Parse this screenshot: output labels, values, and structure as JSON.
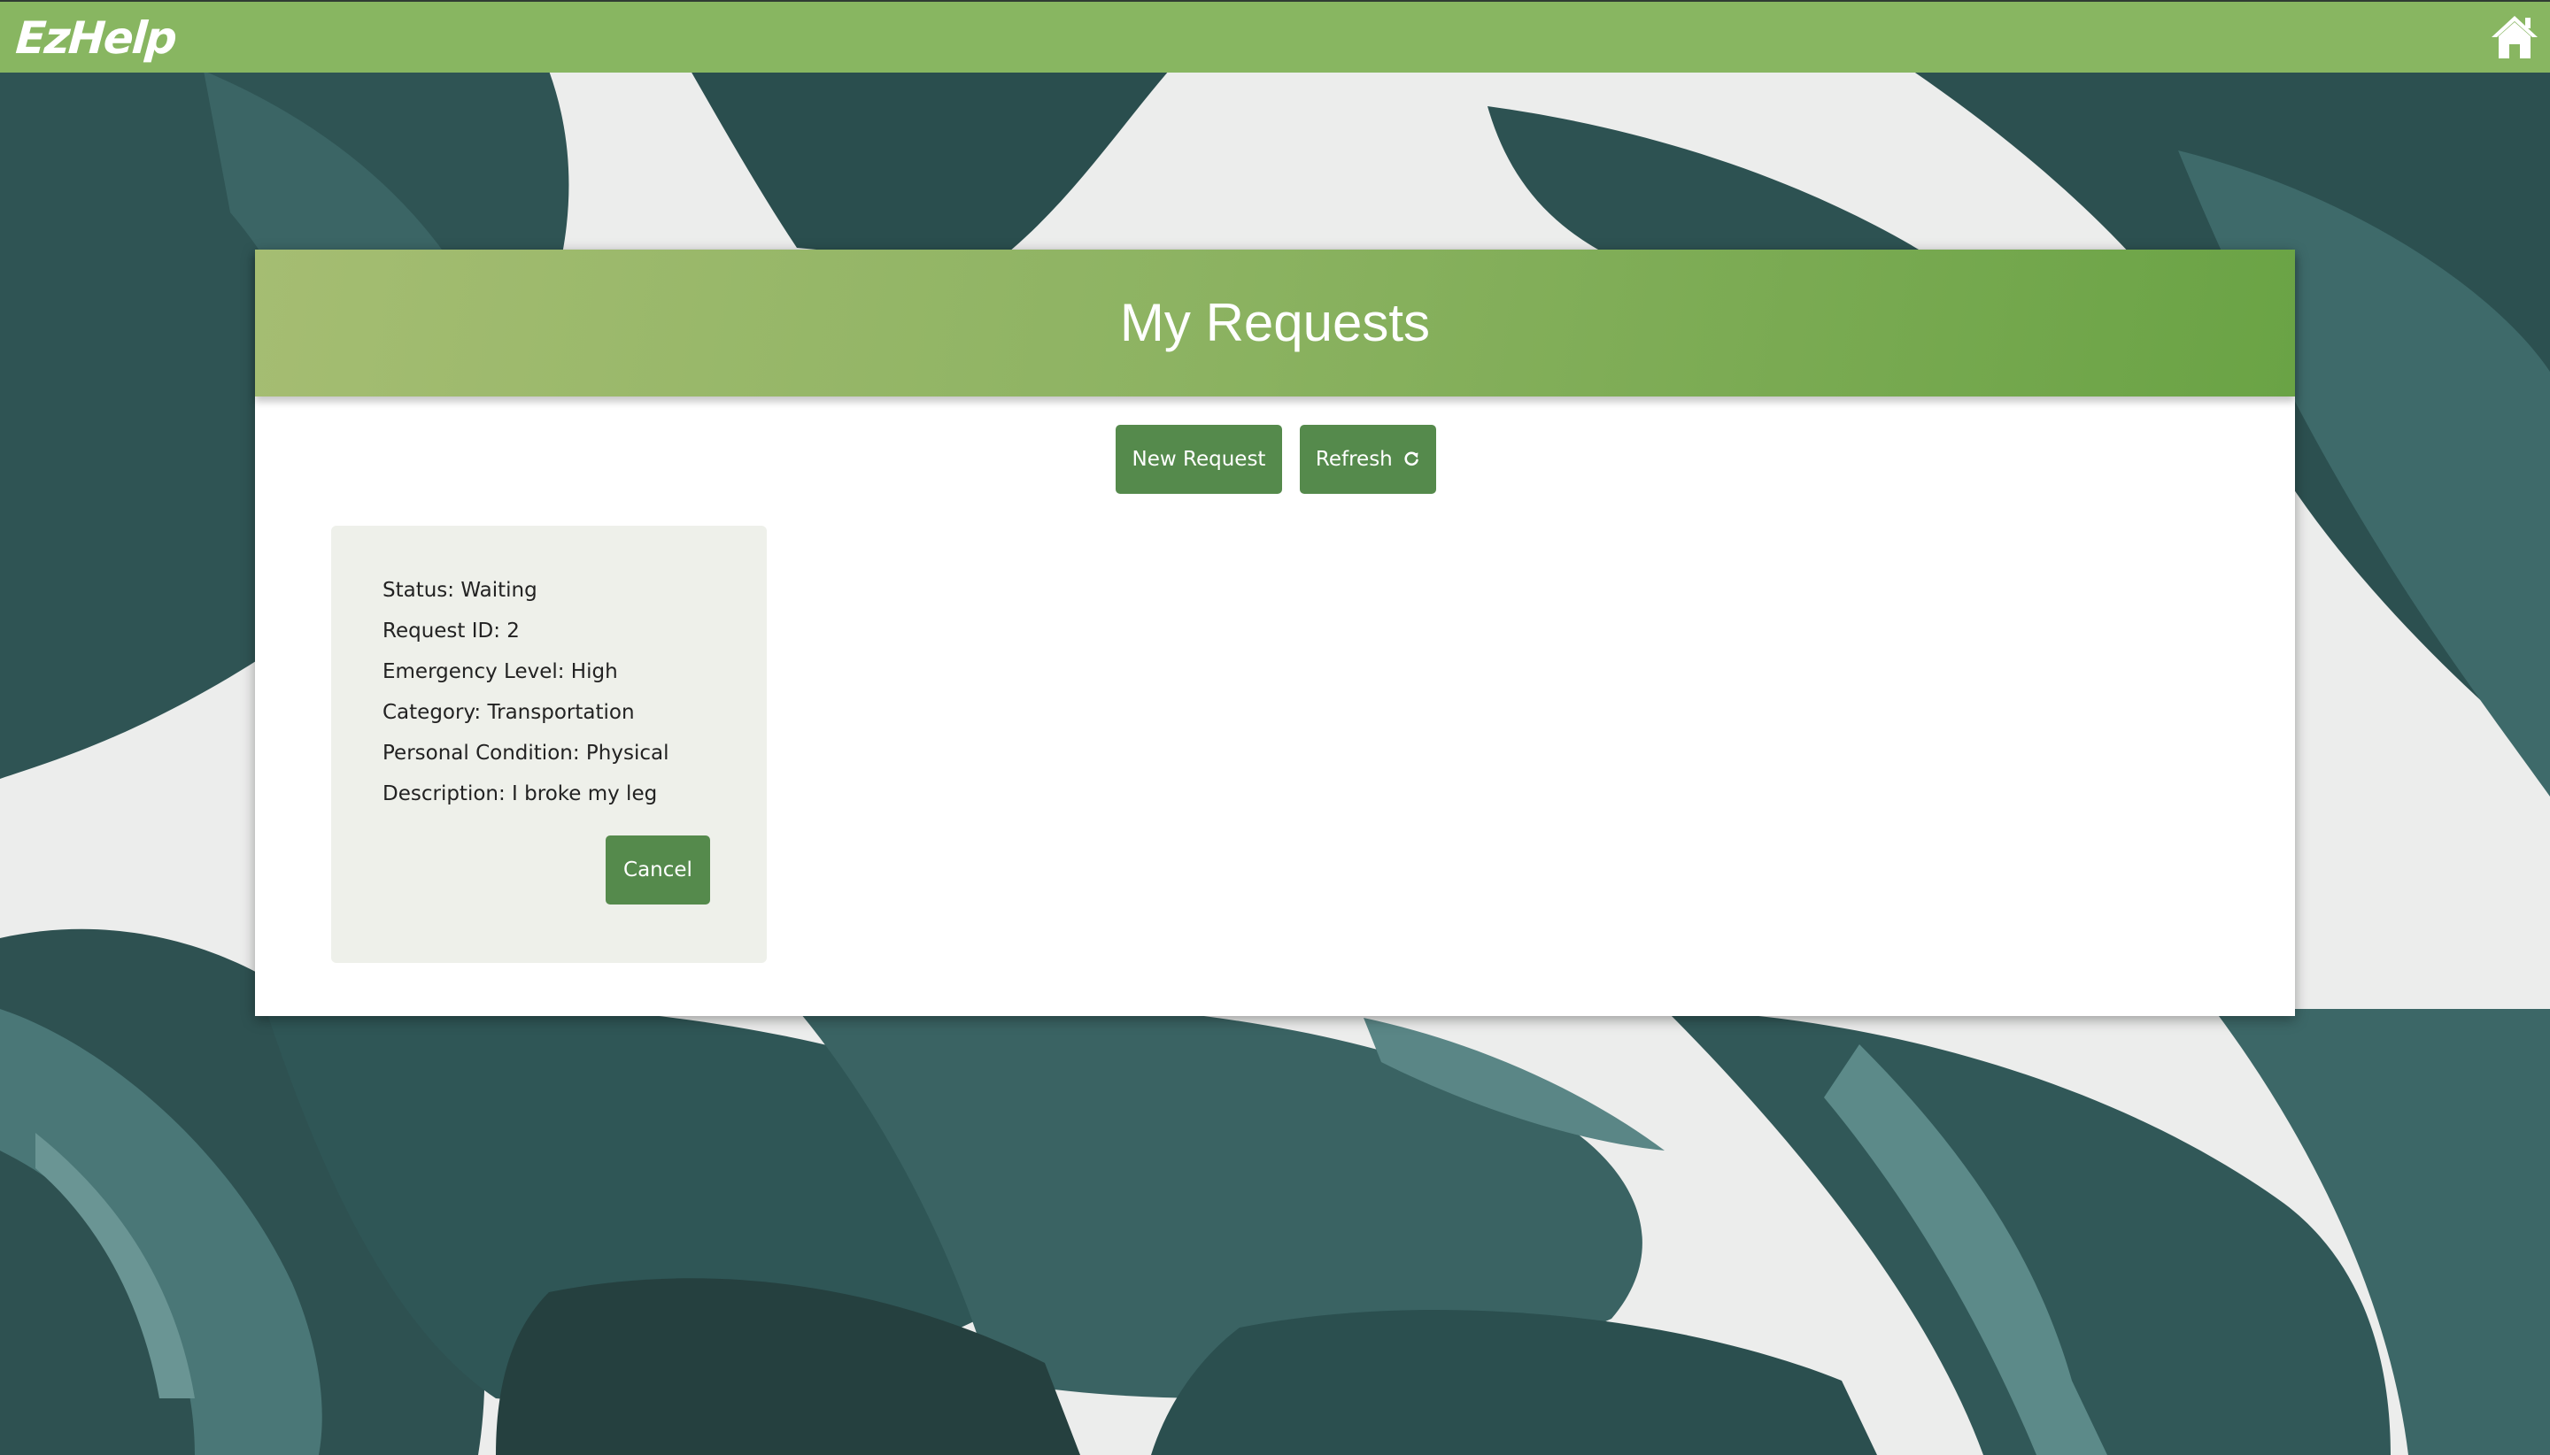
{
  "app": {
    "brand": "EzHelp",
    "home_icon": "home-icon"
  },
  "colors": {
    "navbar": "#88b661",
    "button": "#558a4c",
    "card_header_start": "#a5bd72",
    "card_header_end": "#6aa345",
    "request_card_bg": "#eef0ea"
  },
  "page": {
    "title": "My Requests",
    "new_request_label": "New Request",
    "refresh_label": "Refresh",
    "refresh_icon": "refresh-icon"
  },
  "requests": [
    {
      "status": "Status: Waiting",
      "request_id": "Request ID: 2",
      "emergency_level": "Emergency Level: High",
      "category": "Category: Transportation",
      "personal_condition": "Personal Condition: Physical",
      "description": "Description: I broke my leg",
      "cancel_label": "Cancel"
    }
  ]
}
